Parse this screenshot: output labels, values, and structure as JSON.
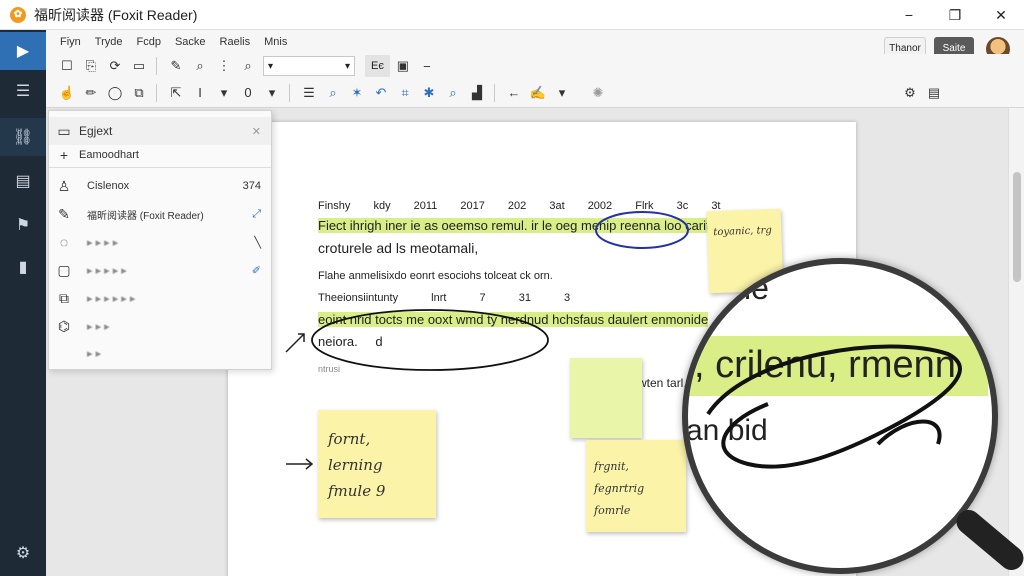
{
  "window": {
    "title": "福昕阅读器 (Foxit Reader)",
    "logo": "foxit-logo",
    "controls": [
      "−",
      "❐",
      "✕"
    ]
  },
  "menu": [
    "Fiyn",
    "Tryde",
    "Fcdp",
    "Sacke",
    "Raelis",
    "Mnis"
  ],
  "header_buttons": {
    "left": "Thanor",
    "right": "Saite"
  },
  "panel": {
    "header": "Egjext",
    "subheader": "Eamoodhart",
    "rows": [
      {
        "label": "Cislenox",
        "right": "374"
      },
      {
        "label": "福昕阅读器 (Foxit Reader)",
        "right": ""
      },
      {
        "label": "▸ ▸ ▸ ▸",
        "right": ""
      },
      {
        "label": "▸ ▸ ▸ ▸ ▸",
        "right": ""
      },
      {
        "label": "▸ ▸ ▸ ▸ ▸ ▸",
        "right": ""
      },
      {
        "label": "▸ ▸ ▸",
        "right": ""
      },
      {
        "label": "▸ ▸",
        "right": ""
      }
    ]
  },
  "document": {
    "row_header": [
      "Finshy kdy",
      "2011",
      "2017",
      "202",
      "3at",
      "2002",
      "Flrk",
      "3c",
      "3t"
    ],
    "line1": "Fiect ihrigh iner ie as oeemso remul. ir le oeg menip reenna  loo carit,",
    "line2": "croturele ad ls meotamali,",
    "line3": "Flahe anmelisixdo eonrt esociohs tolceat ck orn.",
    "line4": [
      "Theeionsiintunty",
      "lnrt",
      "7",
      "31",
      "3"
    ],
    "line5": "eoint nrid tocts me ooxt wmd ty nerdnud hchsfaus daulert enmonide",
    "line6": "neiora.",
    "line6b": "d",
    "line7": "ntrusi",
    "side_word": "wten tarl,"
  },
  "notes": [
    {
      "text1": "toyanic, trg",
      "text2": ""
    },
    {
      "text1": "fornt, lerning",
      "text2": "fmule 9"
    },
    {
      "text1": "frgnit, fegnrtrig",
      "text2": "fomrle"
    }
  ],
  "magnifier": {
    "top": "ie",
    "main": ", crilenu, rmenn",
    "bottom": "an bid"
  },
  "colors": {
    "rail": "#1e2a36",
    "accent": "#2f6fb3",
    "highlight": "#d9ee86",
    "note": "#fbf3a8"
  }
}
